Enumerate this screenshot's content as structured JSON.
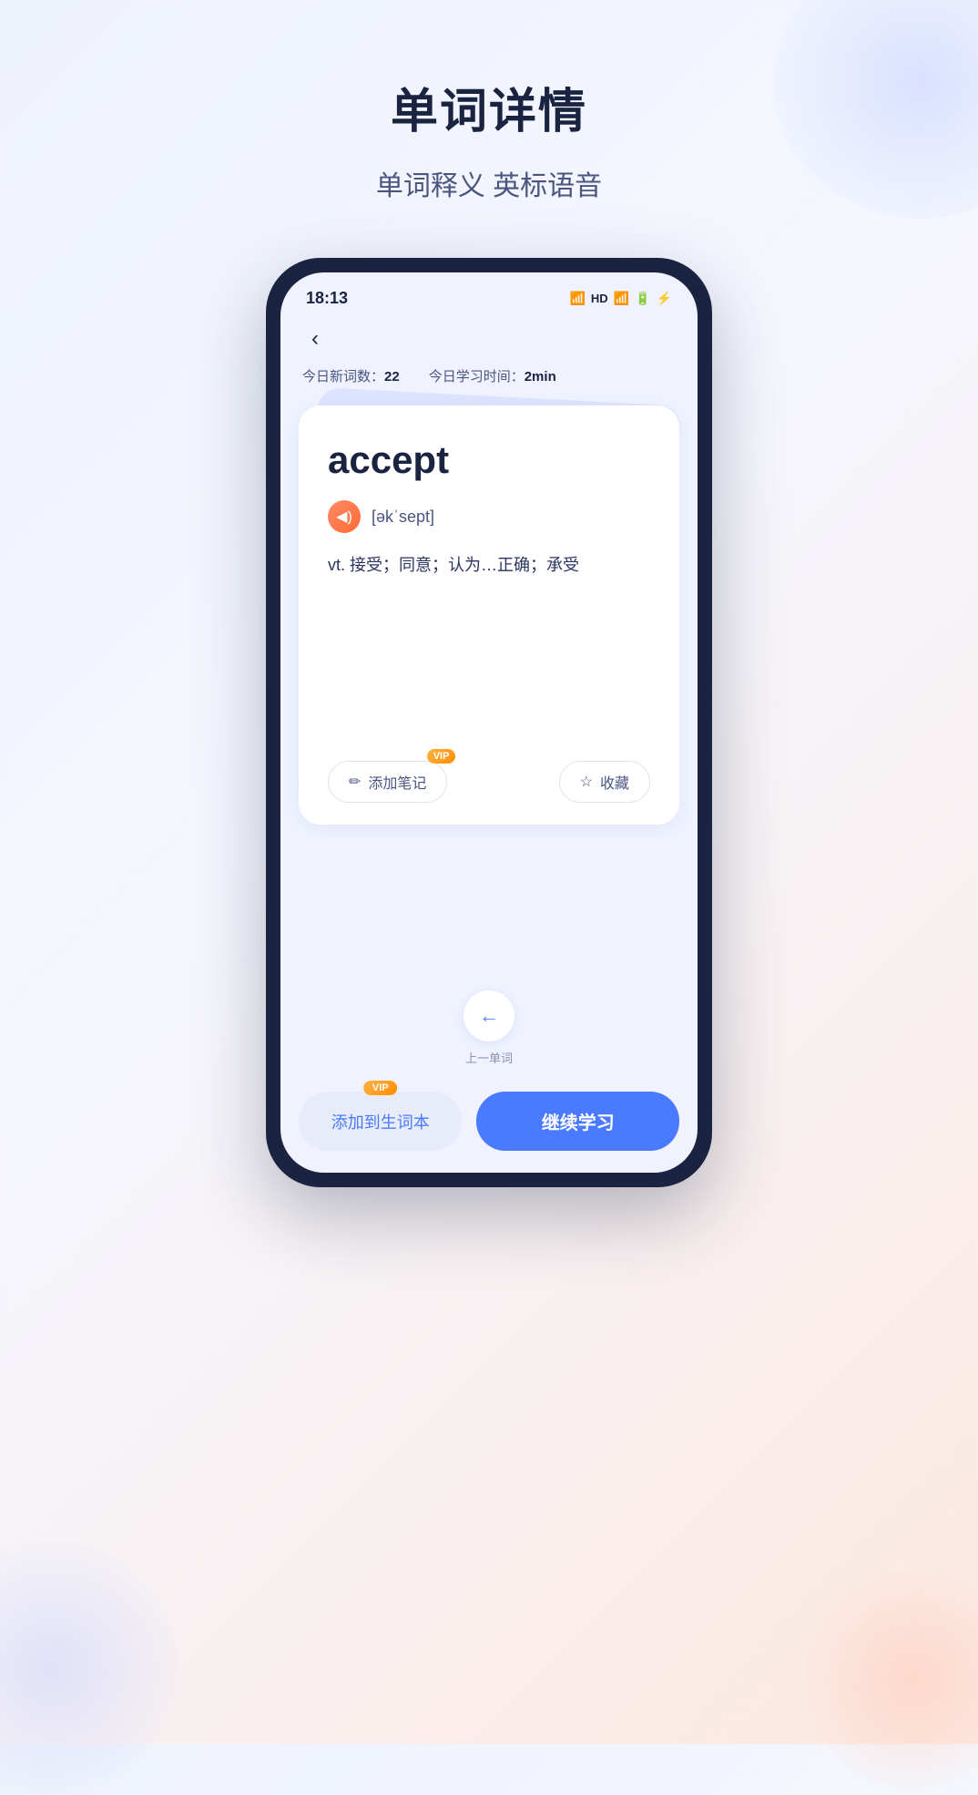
{
  "page": {
    "title": "单词详情",
    "subtitle": "单词释义 英标语音",
    "background_colors": {
      "top_right_blob": "rgba(200,210,255,0.6)",
      "bottom_left_blob": "rgba(200,210,255,0.5)",
      "bottom_right_blob": "rgba(255,200,180,0.5)"
    }
  },
  "phone": {
    "status_bar": {
      "time": "18:13",
      "icons": [
        "wifi",
        "HD",
        "signal",
        "battery"
      ]
    },
    "stats": {
      "new_words_label": "今日新词数：",
      "new_words_value": "22",
      "study_time_label": "今日学习时间：",
      "study_time_value": "2min"
    },
    "word_card": {
      "word": "accept",
      "phonetic": "[əkˈsept]",
      "definition": "vt. 接受；同意；认为…正确；承受",
      "sound_icon": "🔊",
      "actions": {
        "add_note": "添加笔记",
        "add_note_vip": "VIP",
        "favorite": "收藏",
        "favorite_icon": "☆"
      }
    },
    "navigation": {
      "prev_arrow": "←",
      "prev_label": "上一单词"
    },
    "bottom_buttons": {
      "add_to_vocab": "添加到生词本",
      "add_to_vocab_vip": "VIP",
      "continue_learning": "继续学习"
    }
  }
}
